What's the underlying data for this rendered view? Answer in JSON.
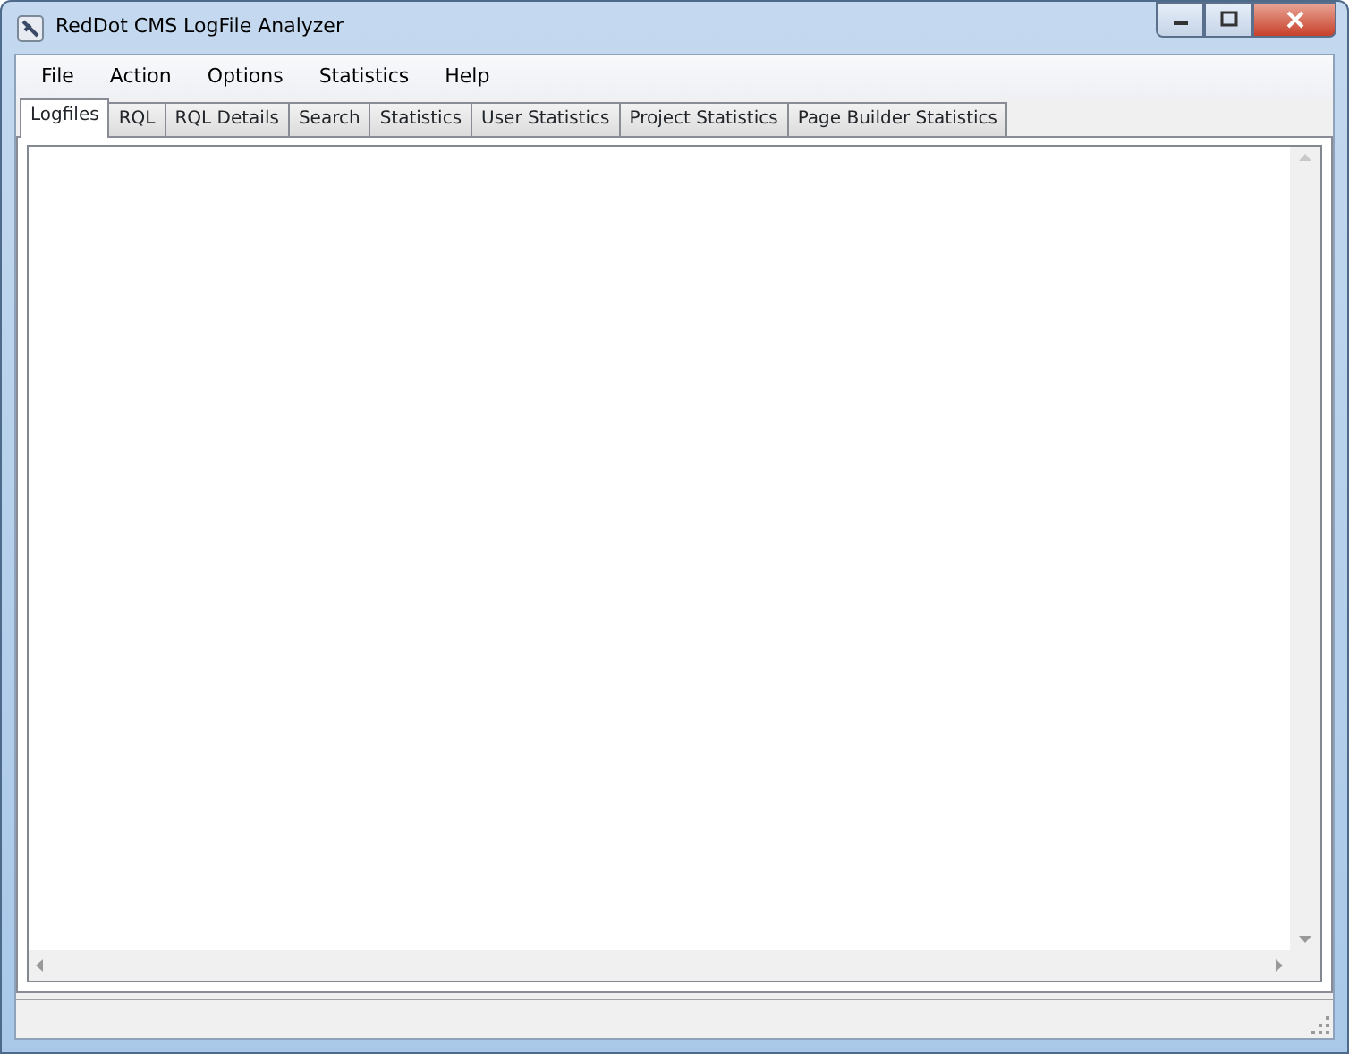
{
  "window": {
    "title": "RedDot CMS LogFile Analyzer"
  },
  "menu": [
    "File",
    "Action",
    "Options",
    "Statistics",
    "Help"
  ],
  "tabs": [
    {
      "label": "Logfiles",
      "selected": true
    },
    {
      "label": "RQL",
      "selected": false
    },
    {
      "label": "RQL Details",
      "selected": false
    },
    {
      "label": "Search",
      "selected": false
    },
    {
      "label": "Statistics",
      "selected": false
    },
    {
      "label": "User Statistics",
      "selected": false
    },
    {
      "label": "Project Statistics",
      "selected": false
    },
    {
      "label": "Page Builder Statistics",
      "selected": false
    }
  ]
}
